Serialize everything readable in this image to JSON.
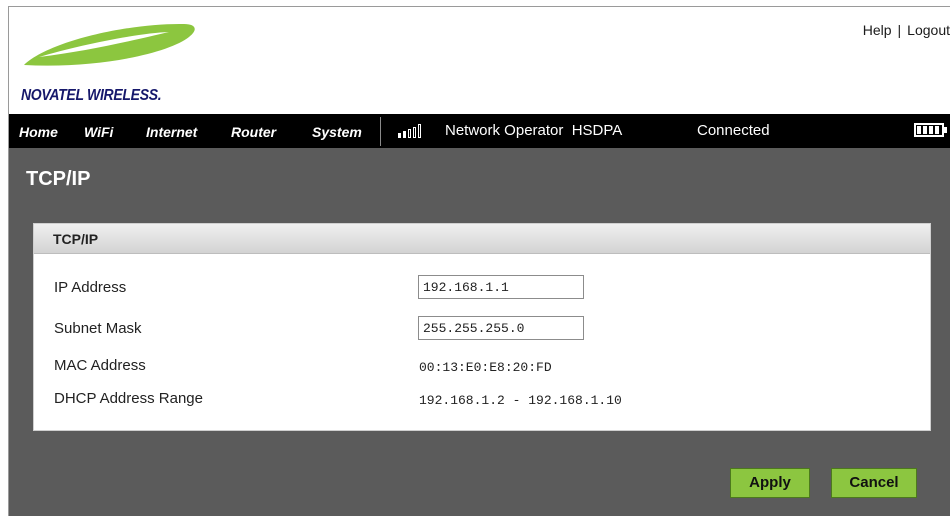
{
  "brand": {
    "logo_text": "NOVATEL WIRELESS.",
    "swoosh_color": "#8cc63f",
    "text_color": "#16186b"
  },
  "header_links": {
    "help": "Help",
    "separator": "|",
    "logout": "Logout"
  },
  "nav": {
    "items": [
      "Home",
      "WiFi",
      "Internet",
      "Router",
      "System"
    ]
  },
  "status": {
    "signal_bars_filled": 2,
    "signal_bars_total": 5,
    "operator": "Network Operator",
    "network_type": "HSDPA",
    "connection": "Connected",
    "battery_cells_filled": 4,
    "battery_cells_total": 4
  },
  "page": {
    "title": "TCP/IP"
  },
  "panel": {
    "title": "TCP/IP",
    "rows": {
      "ip": {
        "label": "IP Address",
        "value": "192.168.1.1"
      },
      "subnet": {
        "label": "Subnet Mask",
        "value": "255.255.255.0"
      },
      "mac": {
        "label": "MAC Address",
        "value": "00:13:E0:E8:20:FD"
      },
      "dhcp": {
        "label": "DHCP Address Range",
        "value": "192.168.1.2 - 192.168.1.10"
      }
    }
  },
  "buttons": {
    "apply": "Apply",
    "cancel": "Cancel",
    "color": "#8cc640"
  },
  "colors": {
    "content_bg": "#5b5b5b",
    "navbar_bg": "#000000"
  }
}
